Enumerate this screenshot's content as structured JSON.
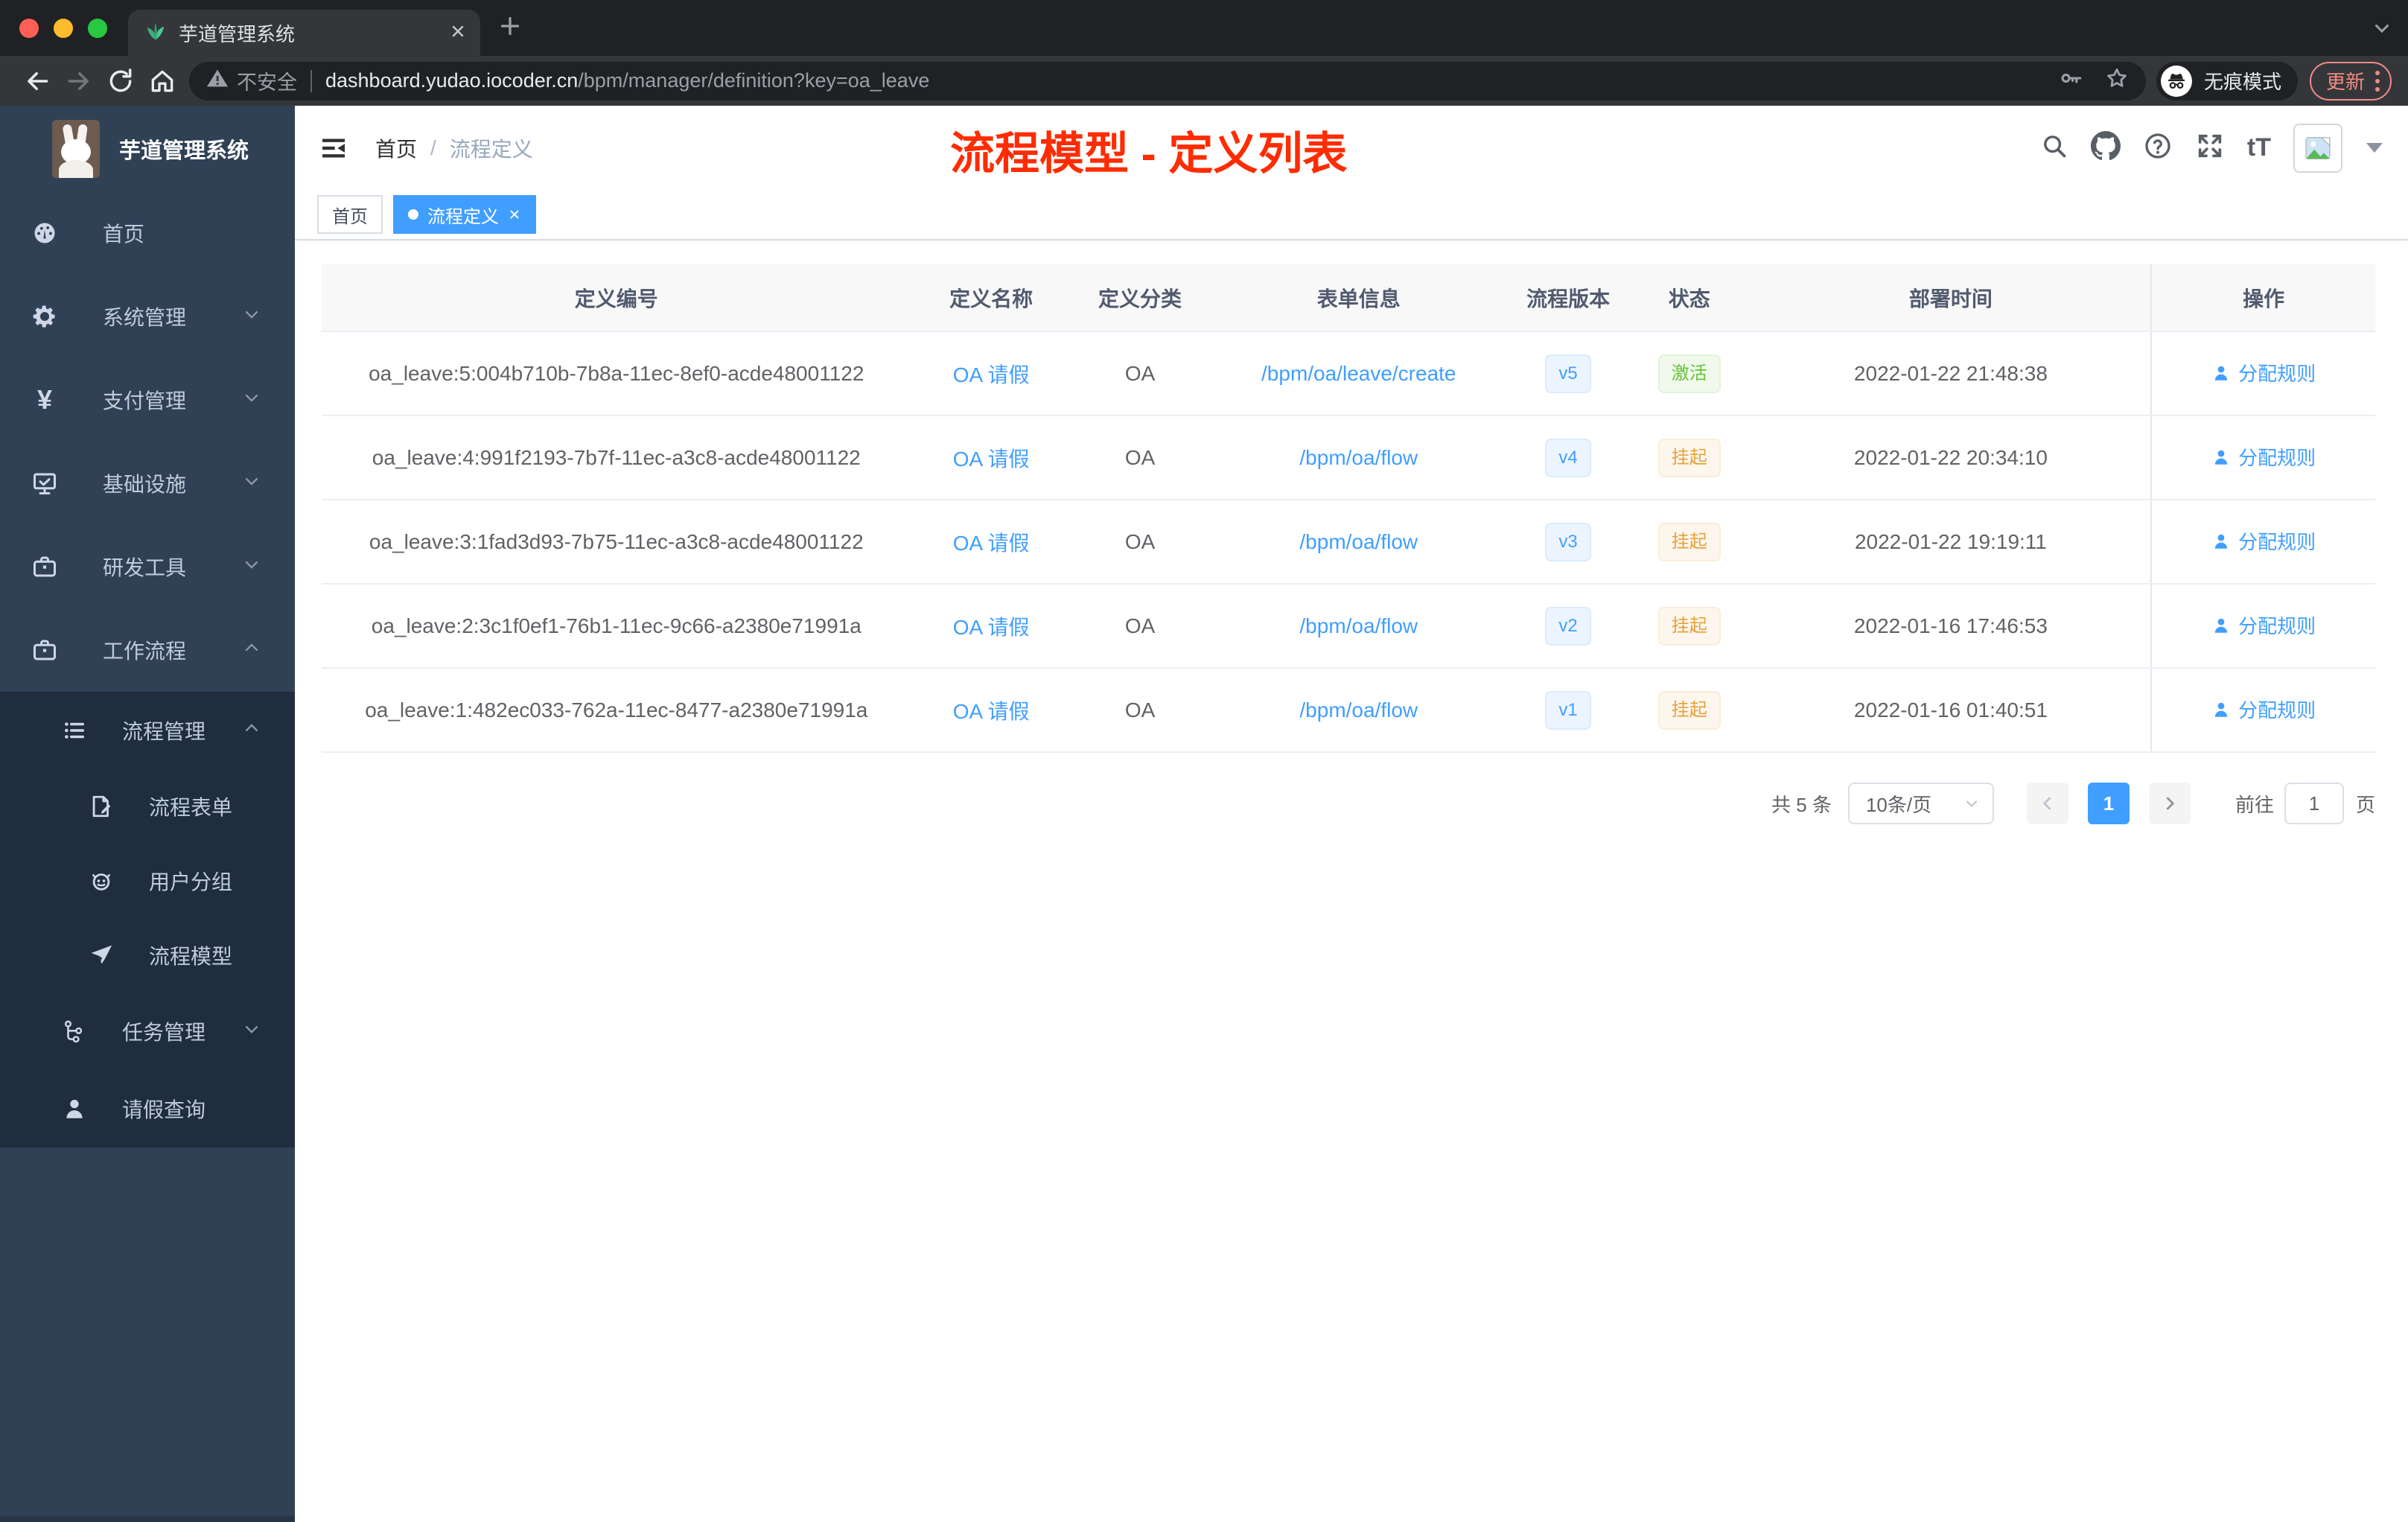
{
  "browser": {
    "tab_title": "芋道管理系统",
    "security_label": "不安全",
    "url_domain": "dashboard.yudao.iocoder.cn",
    "url_path": "/bpm/manager/definition?key=oa_leave",
    "incognito_label": "无痕模式",
    "update_label": "更新"
  },
  "sidebar": {
    "app_title": "芋道管理系统",
    "items": [
      {
        "label": "首页",
        "icon": "dashboard-icon"
      },
      {
        "label": "系统管理",
        "icon": "gear-icon",
        "state": "collapsed"
      },
      {
        "label": "支付管理",
        "icon": "yen-icon",
        "state": "collapsed"
      },
      {
        "label": "基础设施",
        "icon": "monitor-icon",
        "state": "collapsed"
      },
      {
        "label": "研发工具",
        "icon": "toolbox-icon",
        "state": "collapsed"
      },
      {
        "label": "工作流程",
        "icon": "briefcase-icon",
        "state": "expanded",
        "children": [
          {
            "label": "流程管理",
            "icon": "list-icon",
            "state": "expanded",
            "children": [
              {
                "label": "流程表单",
                "icon": "form-icon"
              },
              {
                "label": "用户分组",
                "icon": "robot-icon"
              },
              {
                "label": "流程模型",
                "icon": "paper-plane-icon"
              }
            ]
          },
          {
            "label": "任务管理",
            "icon": "tree-icon",
            "state": "collapsed"
          },
          {
            "label": "请假查询",
            "icon": "person-icon"
          }
        ]
      }
    ]
  },
  "header": {
    "breadcrumb": {
      "items": [
        "首页",
        "流程定义"
      ],
      "separator": "/"
    },
    "annotation": "流程模型 - 定义列表"
  },
  "glyphs": {
    "font_size": "tT",
    "yen": "¥"
  },
  "tags": [
    {
      "label": "首页",
      "active": false
    },
    {
      "label": "流程定义",
      "active": true
    }
  ],
  "table": {
    "columns": [
      "定义编号",
      "定义名称",
      "定义分类",
      "表单信息",
      "流程版本",
      "状态",
      "部署时间",
      "操作"
    ],
    "rows": [
      {
        "id": "oa_leave:5:004b710b-7b8a-11ec-8ef0-acde48001122",
        "name": "OA 请假",
        "category": "OA",
        "form": "/bpm/oa/leave/create",
        "version": "v5",
        "status": "激活",
        "deployed_at": "2022-01-22 21:48:38",
        "action": "分配规则"
      },
      {
        "id": "oa_leave:4:991f2193-7b7f-11ec-a3c8-acde48001122",
        "name": "OA 请假",
        "category": "OA",
        "form": "/bpm/oa/flow",
        "version": "v4",
        "status": "挂起",
        "deployed_at": "2022-01-22 20:34:10",
        "action": "分配规则"
      },
      {
        "id": "oa_leave:3:1fad3d93-7b75-11ec-a3c8-acde48001122",
        "name": "OA 请假",
        "category": "OA",
        "form": "/bpm/oa/flow",
        "version": "v3",
        "status": "挂起",
        "deployed_at": "2022-01-22 19:19:11",
        "action": "分配规则"
      },
      {
        "id": "oa_leave:2:3c1f0ef1-76b1-11ec-9c66-a2380e71991a",
        "name": "OA 请假",
        "category": "OA",
        "form": "/bpm/oa/flow",
        "version": "v2",
        "status": "挂起",
        "deployed_at": "2022-01-16 17:46:53",
        "action": "分配规则"
      },
      {
        "id": "oa_leave:1:482ec033-762a-11ec-8477-a2380e71991a",
        "name": "OA 请假",
        "category": "OA",
        "form": "/bpm/oa/flow",
        "version": "v1",
        "status": "挂起",
        "deployed_at": "2022-01-16 01:40:51",
        "action": "分配规则"
      }
    ]
  },
  "pagination": {
    "total": "共 5 条",
    "page_size": "10条/页",
    "page": "1",
    "goto_label": "前往",
    "goto_value": "1",
    "unit": "页"
  },
  "colors": {
    "accent_blue": "#409eff",
    "success_green": "#67c23a",
    "warning_orange": "#e6a23c",
    "annotation_red": "#fe2c00",
    "update_salmon": "#f28b82",
    "sidebar_bg": "#304156",
    "submenu_bg": "#1f2d3d",
    "table_header_bg": "#f8f8f9"
  }
}
